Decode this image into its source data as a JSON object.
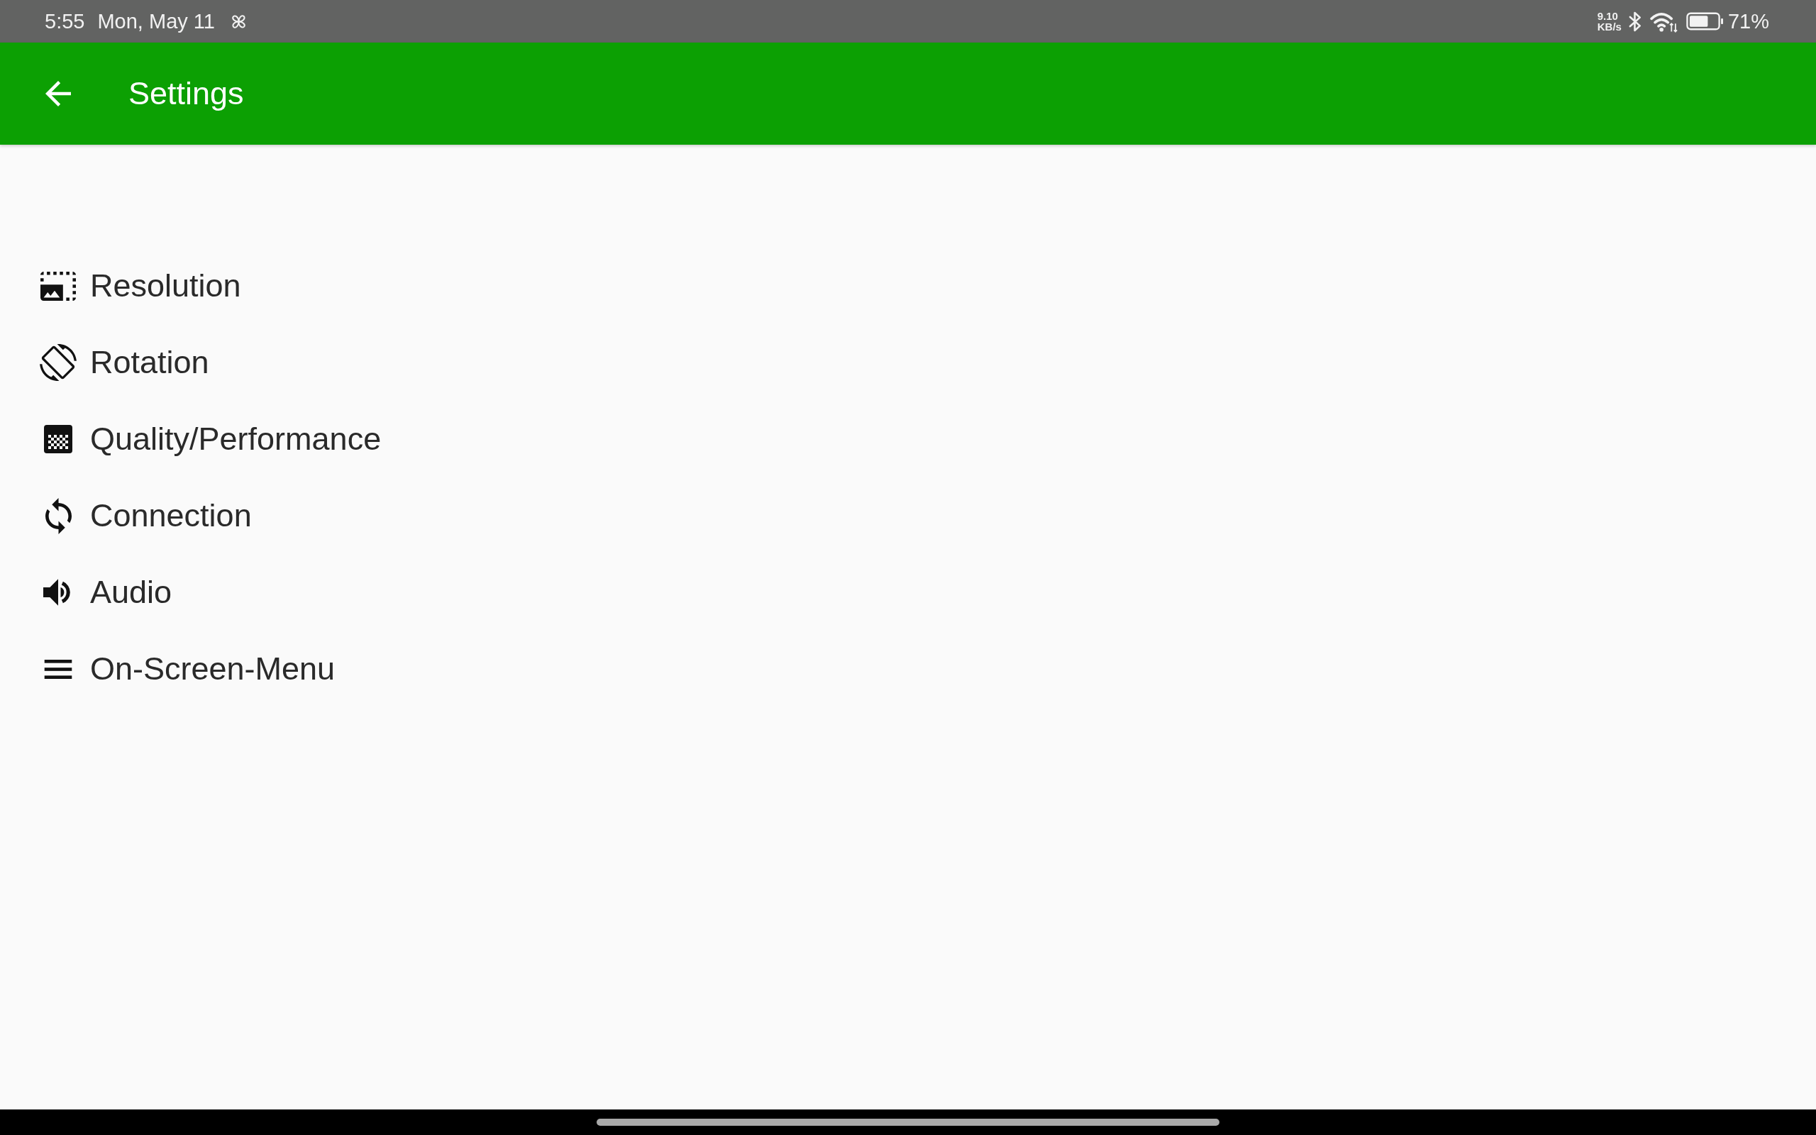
{
  "status_bar": {
    "time": "5:55",
    "date": "Mon, May 11",
    "network_speed": {
      "value": "9.10",
      "unit": "KB/s"
    },
    "battery_percent": "71%"
  },
  "app_bar": {
    "title": "Settings"
  },
  "settings": {
    "items": [
      {
        "kind": "resolution",
        "label": "Resolution"
      },
      {
        "kind": "rotation",
        "label": "Rotation"
      },
      {
        "kind": "quality",
        "label": "Quality/Performance"
      },
      {
        "kind": "connection",
        "label": "Connection"
      },
      {
        "kind": "audio",
        "label": "Audio"
      },
      {
        "kind": "menu",
        "label": "On-Screen-Menu"
      }
    ]
  }
}
